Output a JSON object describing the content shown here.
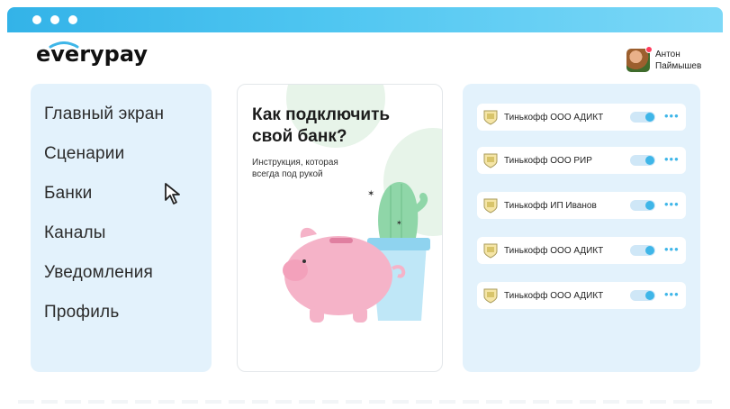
{
  "app": {
    "brand": "everypay",
    "accent": "#3fb6e8",
    "window_controls": [
      "dot",
      "dot",
      "dot"
    ]
  },
  "user": {
    "name_line1": "Антон",
    "name_line2": "Паймышев",
    "has_notification": true
  },
  "sidebar": {
    "items": [
      {
        "label": "Главный экран"
      },
      {
        "label": "Сценарии"
      },
      {
        "label": "Банки"
      },
      {
        "label": "Каналы"
      },
      {
        "label": "Уведомления"
      },
      {
        "label": "Профиль"
      }
    ]
  },
  "promo": {
    "title_line1": "Как подключить",
    "title_line2": "свой банк?",
    "subtitle_line1": "Инструкция, которая",
    "subtitle_line2": "всегда под рукой"
  },
  "banks": {
    "items": [
      {
        "name": "Тинькофф ООО АДИКТ",
        "enabled": true,
        "logo_icon": "tinkoff-emblem-icon",
        "more_icon": "more-dots-icon"
      },
      {
        "name": "Тинькофф ООО РИР",
        "enabled": true,
        "logo_icon": "tinkoff-emblem-icon",
        "more_icon": "more-dots-icon"
      },
      {
        "name": "Тинькофф ИП Иванов",
        "enabled": true,
        "logo_icon": "tinkoff-emblem-icon",
        "more_icon": "more-dots-icon"
      },
      {
        "name": "Тинькофф ООО АДИКТ",
        "enabled": true,
        "logo_icon": "tinkoff-emblem-icon",
        "more_icon": "more-dots-icon"
      },
      {
        "name": "Тинькофф ООО АДИКТ",
        "enabled": true,
        "logo_icon": "tinkoff-emblem-icon",
        "more_icon": "more-dots-icon"
      }
    ]
  }
}
